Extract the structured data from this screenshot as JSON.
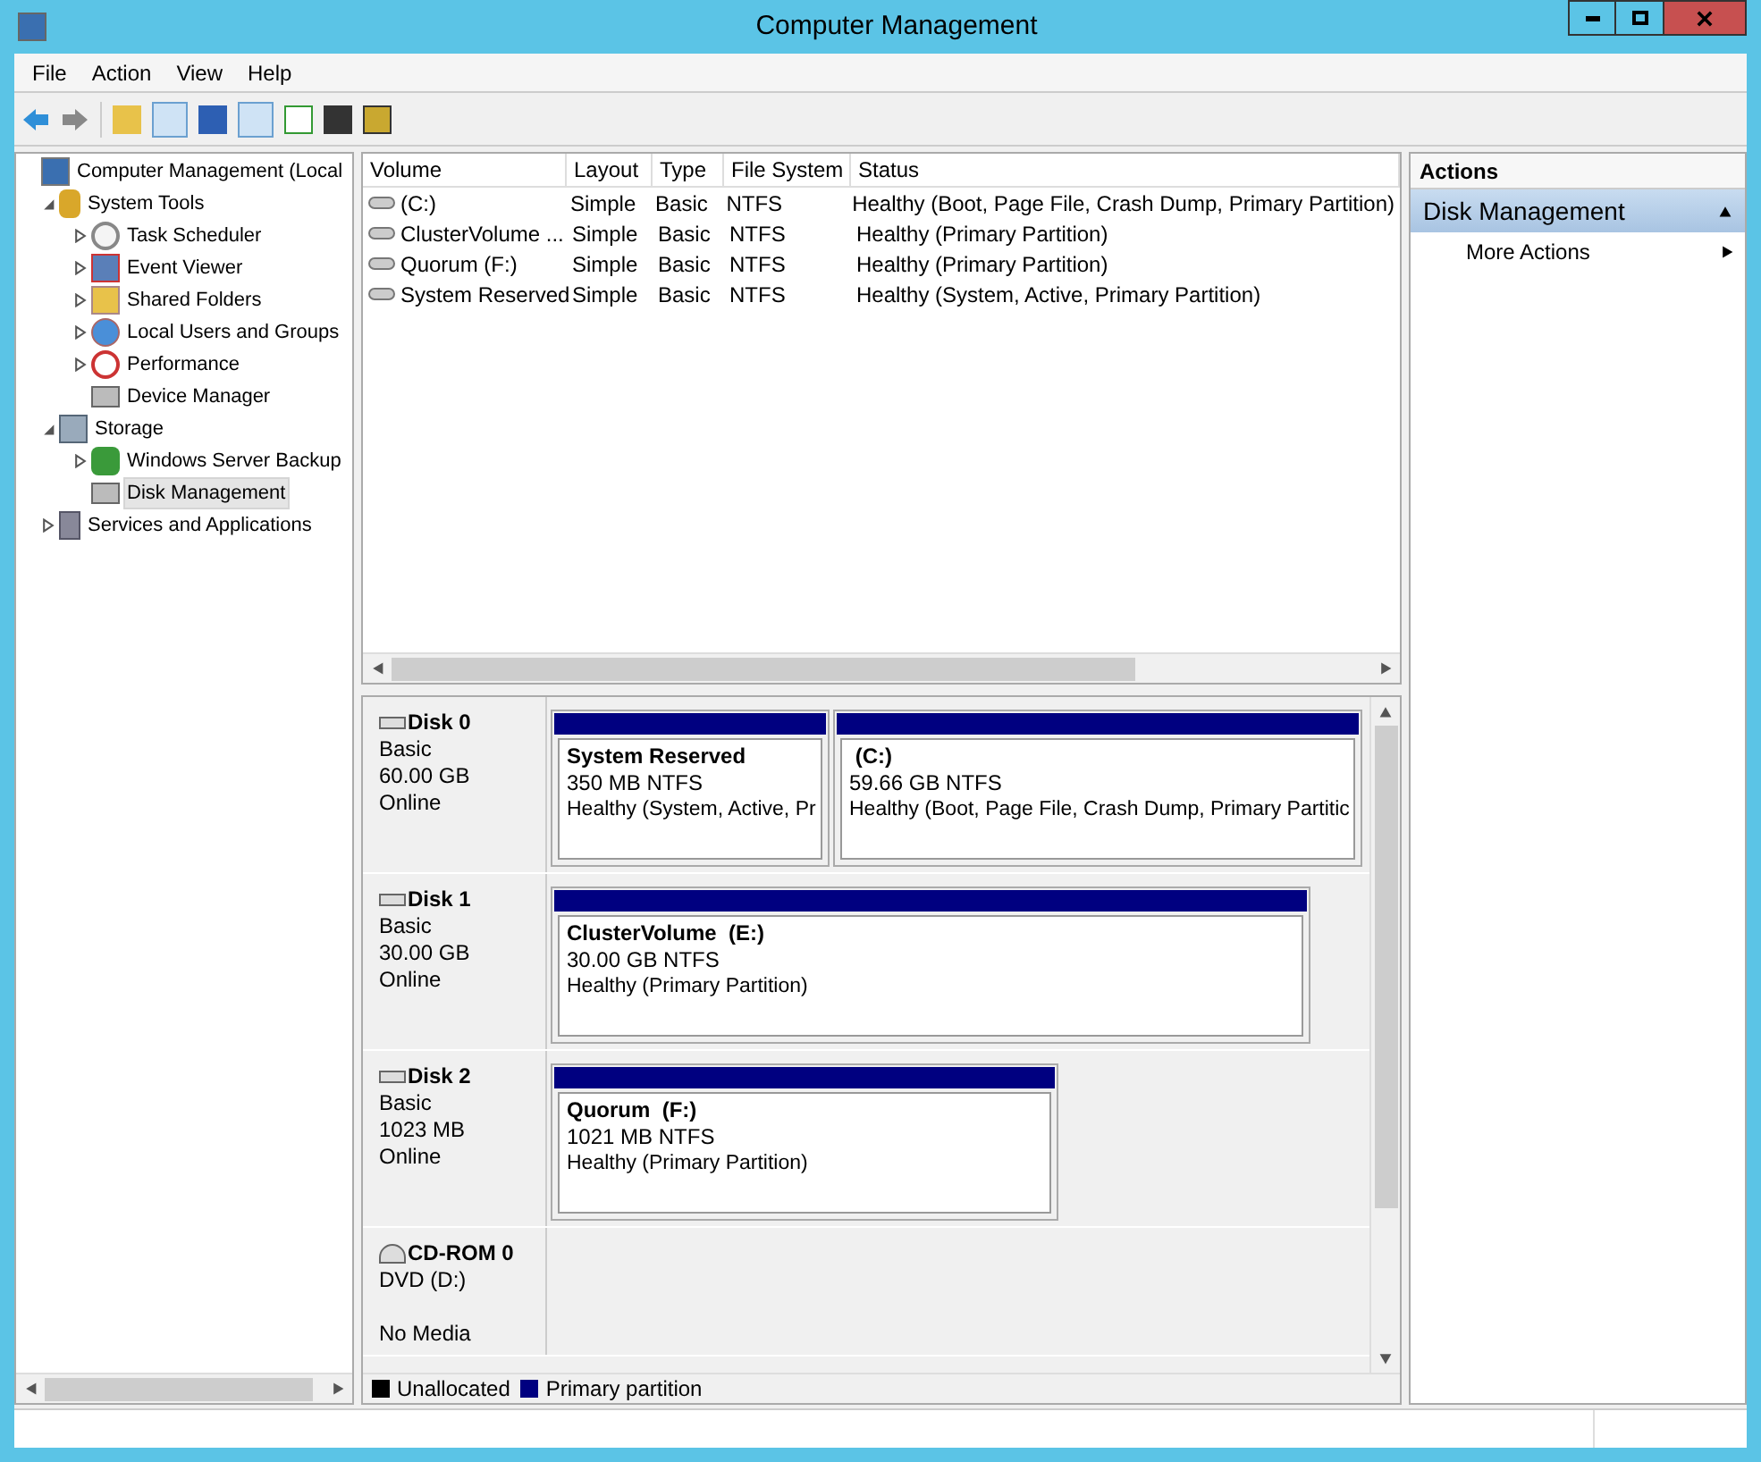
{
  "window": {
    "title": "Computer Management"
  },
  "menu": [
    "File",
    "Action",
    "View",
    "Help"
  ],
  "tree": [
    {
      "label": "Computer Management (Local",
      "selected": false,
      "children": [
        {
          "label": "System Tools",
          "expanded": true,
          "selected": false,
          "children": [
            {
              "label": "Task Scheduler",
              "expanded": false,
              "selected": false
            },
            {
              "label": "Event Viewer",
              "expanded": false,
              "selected": false
            },
            {
              "label": "Shared Folders",
              "expanded": false,
              "selected": false
            },
            {
              "label": "Local Users and Groups",
              "expanded": false,
              "selected": false
            },
            {
              "label": "Performance",
              "expanded": false,
              "selected": false
            },
            {
              "label": "Device Manager",
              "selected": false
            }
          ]
        },
        {
          "label": "Storage",
          "expanded": true,
          "selected": false,
          "children": [
            {
              "label": "Windows Server Backup",
              "expanded": false,
              "selected": false
            },
            {
              "label": "Disk Management",
              "selected": true
            }
          ]
        },
        {
          "label": "Services and Applications",
          "expanded": false,
          "selected": false
        }
      ]
    }
  ],
  "volumes": {
    "columns": [
      "Volume",
      "Layout",
      "Type",
      "File System",
      "Status"
    ],
    "rows": [
      [
        "(C:)",
        "Simple",
        "Basic",
        "NTFS",
        "Healthy (Boot, Page File, Crash Dump, Primary Partition)"
      ],
      [
        "ClusterVolume ...",
        "Simple",
        "Basic",
        "NTFS",
        "Healthy (Primary Partition)"
      ],
      [
        "Quorum (F:)",
        "Simple",
        "Basic",
        "NTFS",
        "Healthy (Primary Partition)"
      ],
      [
        "System Reserved",
        "Simple",
        "Basic",
        "NTFS",
        "Healthy (System, Active, Primary Partition)"
      ]
    ]
  },
  "disks": [
    {
      "kind": "disk",
      "name": "Disk 0",
      "type": "Basic",
      "size": "60.00 GB",
      "status": "Online",
      "partitions": [
        {
          "name": "System Reserved",
          "size": "350 MB NTFS",
          "status": "Healthy (System, Active, Pr"
        },
        {
          "name": " (C:)",
          "size": "59.66 GB NTFS",
          "status": "Healthy (Boot, Page File, Crash Dump, Primary Partitic"
        }
      ]
    },
    {
      "kind": "disk",
      "name": "Disk 1",
      "type": "Basic",
      "size": "30.00 GB",
      "status": "Online",
      "partitions": [
        {
          "name": "ClusterVolume  (E:)",
          "size": "30.00 GB NTFS",
          "status": "Healthy (Primary Partition)"
        }
      ]
    },
    {
      "kind": "disk",
      "name": "Disk 2",
      "type": "Basic",
      "size": "1023 MB",
      "status": "Online",
      "partitions": [
        {
          "name": "Quorum  (F:)",
          "size": "1021 MB NTFS",
          "status": "Healthy (Primary Partition)"
        }
      ]
    },
    {
      "kind": "cdrom",
      "name": "CD-ROM 0",
      "type": "DVD (D:)",
      "status": "No Media"
    }
  ],
  "legend": [
    {
      "label": "Unallocated",
      "color": "#000000"
    },
    {
      "label": "Primary partition",
      "color": "#000080"
    }
  ],
  "actions": {
    "title": "Actions",
    "section": "Disk Management",
    "expanded": true,
    "items": [
      "More Actions"
    ]
  }
}
